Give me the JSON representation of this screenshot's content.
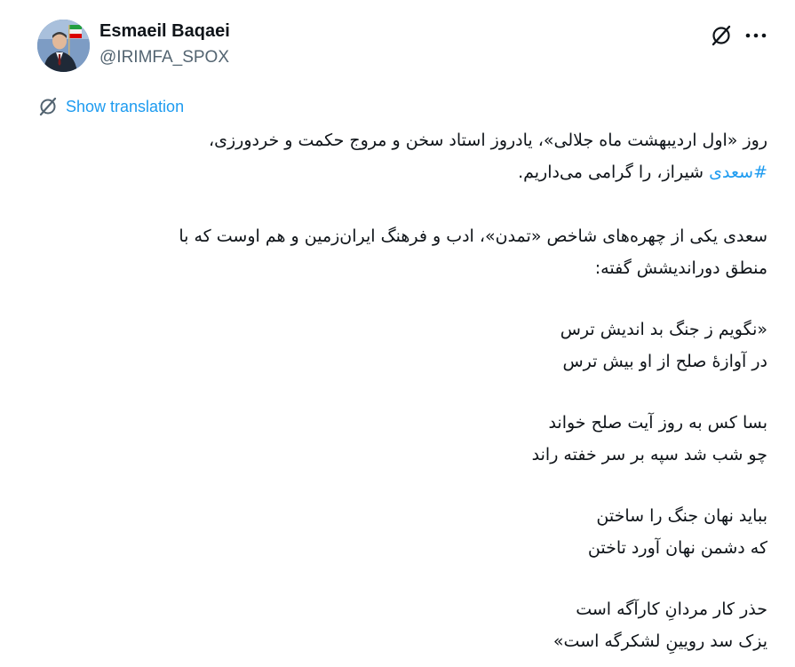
{
  "author": {
    "name": "Esmaeil Baqaei",
    "handle": "@IRIMFA_SPOX",
    "avatar_icon": "profile-photo"
  },
  "actions": {
    "grok_icon": "grok-icon",
    "more_icon": "more-options-icon"
  },
  "translate": {
    "label": "Show translation",
    "icon": "grok-icon"
  },
  "tweet": {
    "line1": "روز «اول اردیبهشت ماه جلالی»، یادروز استاد سخن و مروج حکمت و خردورزی،",
    "hashtag": "#سعدی",
    "line2_rest": " شیراز، را گرامی می‌داریم.",
    "para2_line1": "سعدی یکی از چهره‌های شاخص «تمدن»، ادب و فرهنگ ایران‌زمین و هم اوست که با",
    "para2_line2": "منطق دوراندیشش گفته:",
    "poem": [
      "«نگویم ز جنگ بد اندیش ترس",
      "در آوازۀ صلح از او بیش ترس",
      "بسا کس به روز آیت صلح خواند",
      "چو شب شد سپه بر سر خفته راند",
      "بباید نهان جنگ را ساختن",
      "که دشمن نهان آورد تاختن",
      "حذر کار مردانِ کارآگه است",
      "یزک سد رویینِ لشکرگه است»"
    ]
  },
  "colors": {
    "accent": "#1d9bf0",
    "text": "#0f1419",
    "muted": "#536471"
  }
}
